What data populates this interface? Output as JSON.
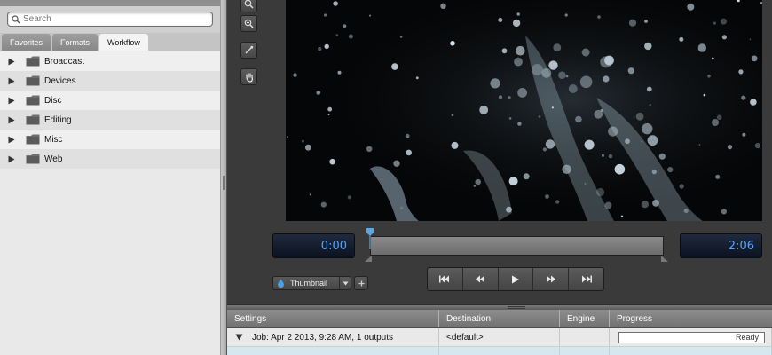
{
  "search": {
    "placeholder": "Search"
  },
  "tabs": [
    {
      "label": "Favorites",
      "active": false
    },
    {
      "label": "Formats",
      "active": false
    },
    {
      "label": "Workflow",
      "active": true
    }
  ],
  "tree": [
    {
      "label": "Broadcast",
      "icon": "folder-icon"
    },
    {
      "label": "Devices",
      "icon": "folder-icon"
    },
    {
      "label": "Disc",
      "icon": "folder-icon"
    },
    {
      "label": "Editing",
      "icon": "folder-icon"
    },
    {
      "label": "Misc",
      "icon": "folder-icon"
    },
    {
      "label": "Web",
      "icon": "folder-icon"
    }
  ],
  "tools": [
    "zoom-in-icon",
    "zoom-out-icon",
    "eyedropper-icon",
    "hand-icon"
  ],
  "preview": {
    "image": "water-splash-image"
  },
  "timecode": {
    "current": "0:00",
    "duration": "2:06"
  },
  "thumbnail": {
    "label": "Thumbnail"
  },
  "transport": [
    "skip-back-icon",
    "rewind-icon",
    "play-icon",
    "fast-forward-icon",
    "skip-forward-icon"
  ],
  "batch": {
    "columns": [
      "Settings",
      "Destination",
      "Engine",
      "Progress"
    ],
    "job": {
      "settings": "Job: Apr 2 2013, 9:28 AM, 1 outputs",
      "destination": "<default>",
      "engine": "",
      "status": "Ready"
    }
  },
  "colors": {
    "accent": "#4fa3ff",
    "panel": "#3a3a3a",
    "sidebar": "#e9e9e9"
  }
}
